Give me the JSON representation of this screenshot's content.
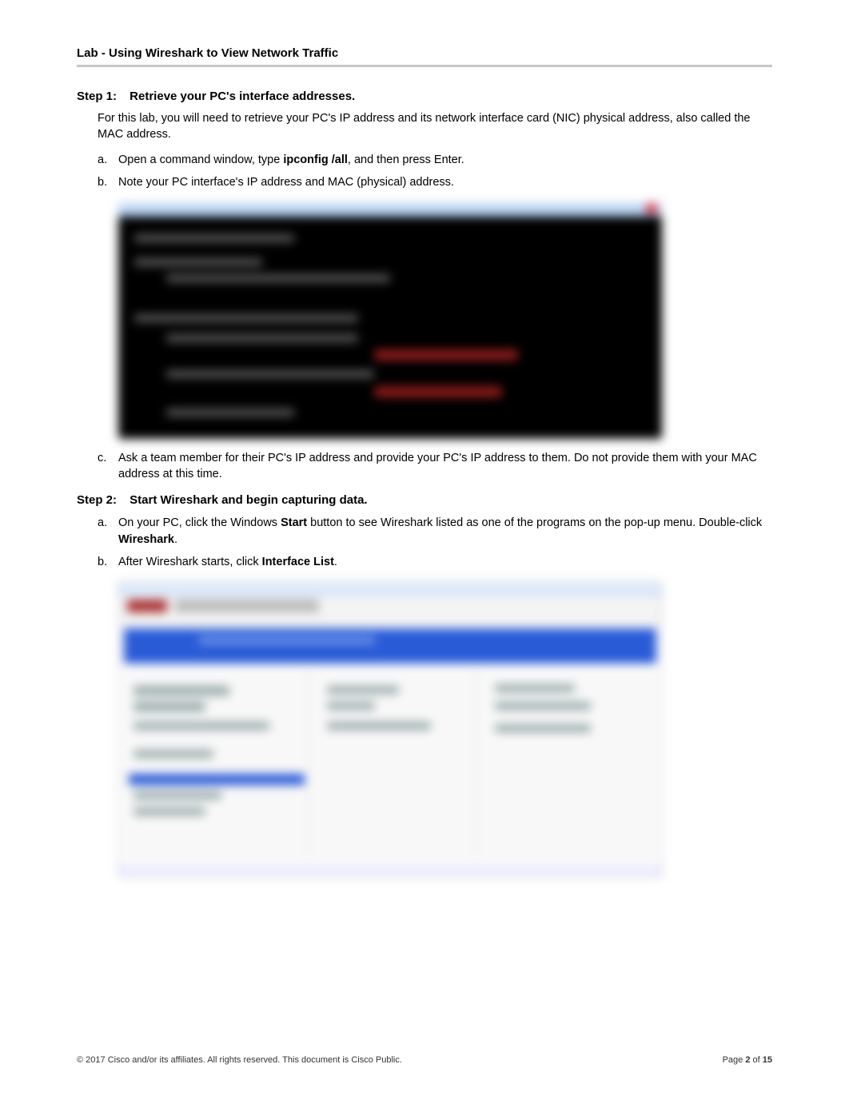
{
  "header": "Lab - Using Wireshark to View Network Traffic",
  "step1": {
    "label": "Step 1:",
    "title": "Retrieve your PC's interface addresses.",
    "intro": "For this lab, you will need to retrieve your PC's IP address and its network interface card (NIC) physical address, also called the MAC address.",
    "a_pre": "Open a command window, type ",
    "a_cmd": "ipconfig /all",
    "a_post": ", and then press Enter.",
    "b": "Note your PC interface's IP address and MAC (physical) address.",
    "c": "Ask a team member for their PC's IP address and provide your PC's IP address to them. Do not provide them with your MAC address at this time."
  },
  "step2": {
    "label": "Step 2:",
    "title": "Start Wireshark and begin capturing data.",
    "a_pre": "On your PC, click the Windows ",
    "a_start": "Start",
    "a_mid": " button to see Wireshark listed as one of the programs on the pop-up menu. Double-click ",
    "a_ws": "Wireshark",
    "a_post": ".",
    "b_pre": "After Wireshark starts, click ",
    "b_il": "Interface List",
    "b_post": "."
  },
  "letters": {
    "a": "a.",
    "b": "b.",
    "c": "c."
  },
  "footer": {
    "copyright": "© 2017 Cisco and/or its affiliates. All rights reserved. This document is Cisco Public.",
    "page_pre": "Page ",
    "page_num": "2",
    "page_mid": " of ",
    "page_total": "15"
  }
}
